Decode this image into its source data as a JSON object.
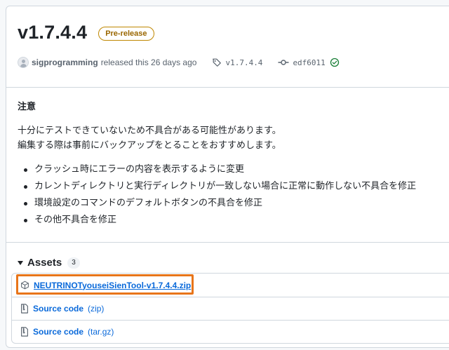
{
  "release": {
    "title": "v1.7.4.4",
    "badge": "Pre-release",
    "author": "sigprogramming",
    "released_text": "released this 26 days ago",
    "tag": "v1.7.4.4",
    "commit": "edf6011"
  },
  "notes": {
    "heading": "注意",
    "paragraph_line1": "十分にテストできていないため不具合がある可能性があります。",
    "paragraph_line2": "編集する際は事前にバックアップをとることをおすすめします。",
    "changes": [
      "クラッシュ時にエラーの内容を表示するように変更",
      "カレントディレクトリと実行ディレクトリが一致しない場合に正常に動作しない不具合を修正",
      "環境設定のコマンドのデフォルトボタンの不具合を修正",
      "その他不具合を修正"
    ]
  },
  "assets": {
    "title": "Assets",
    "count": "3",
    "items": [
      {
        "label": "NEUTRINOTyouseiSienTool-v1.7.4.4.zip",
        "icon": "package-icon"
      },
      {
        "label": "Source code",
        "sub": "(zip)",
        "icon": "file-zip-icon"
      },
      {
        "label": "Source code",
        "sub": "(tar.gz)",
        "icon": "file-zip-icon"
      }
    ]
  },
  "colors": {
    "accent_link": "#0969da",
    "prerelease": "#9a6700",
    "verified": "#1a7f37",
    "highlight": "#e8751a"
  }
}
